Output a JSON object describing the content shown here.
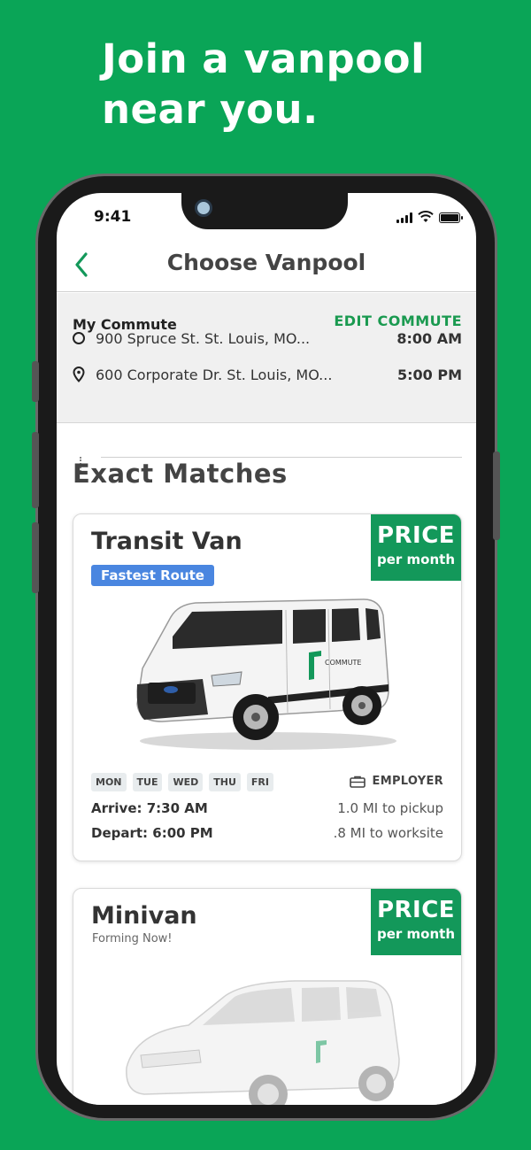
{
  "headline": [
    "Join a vanpool",
    "near you."
  ],
  "status": {
    "time": "9:41"
  },
  "nav": {
    "title": "Choose Vanpool",
    "back_icon": "chevron-left-icon"
  },
  "commute": {
    "label": "My Commute",
    "edit_label": "EDIT COMMUTE",
    "origin": {
      "address": "900 Spruce St. St. Louis, MO...",
      "time": "8:00 AM"
    },
    "destination": {
      "address": "600 Corporate Dr. St. Louis, MO...",
      "time": "5:00 PM"
    }
  },
  "section_title": "Exact Matches",
  "cards": [
    {
      "title": "Transit Van",
      "badge": "Fastest Route",
      "price_label": "PRICE",
      "price_unit": "per month",
      "days": [
        "MON",
        "TUE",
        "WED",
        "THU",
        "FRI"
      ],
      "employer_label": "EMPLOYER",
      "arrive": "Arrive: 7:30 AM",
      "depart": "Depart: 6:00 PM",
      "pickup_distance": "1.0 MI to pickup",
      "worksite_distance": ".8 MI to worksite"
    },
    {
      "title": "Minivan",
      "subtitle": "Forming Now!",
      "price_label": "PRICE",
      "price_unit": "per month"
    }
  ],
  "colors": {
    "background": "#0aa557",
    "accent": "#13985a",
    "badge": "#4a86e0"
  }
}
